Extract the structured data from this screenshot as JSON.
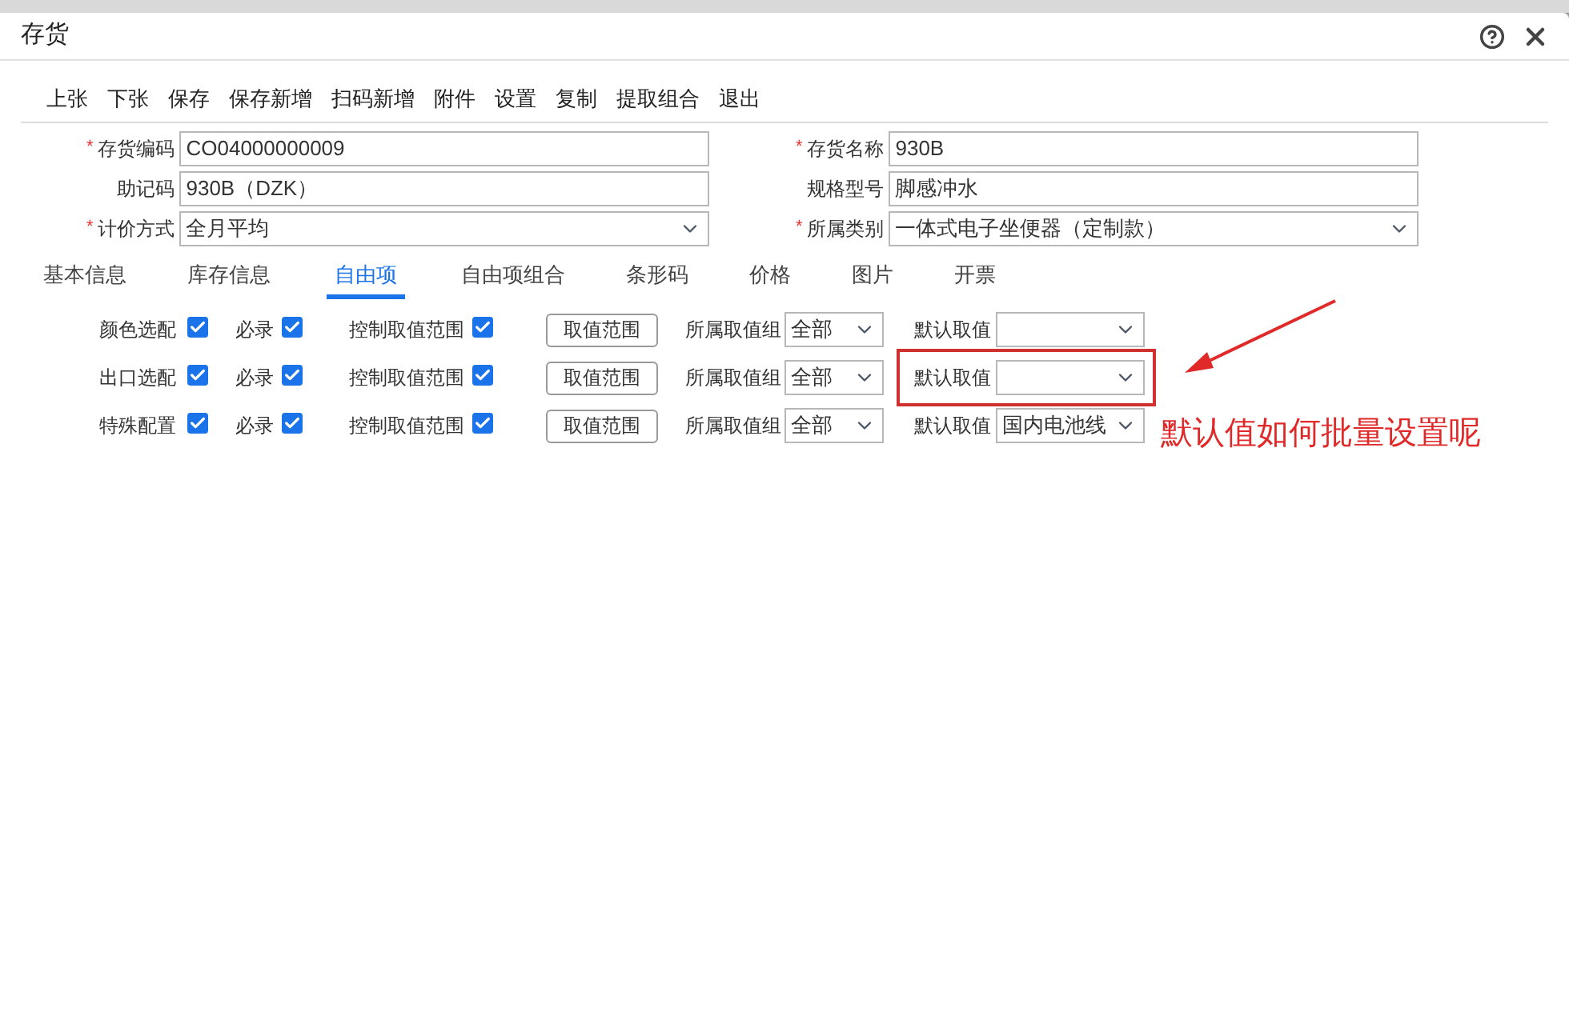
{
  "window": {
    "title": "存货"
  },
  "toolbar": [
    "上张",
    "下张",
    "保存",
    "保存新增",
    "扫码新增",
    "附件",
    "设置",
    "复制",
    "提取组合",
    "退出"
  ],
  "fields": [
    {
      "label": "存货编码",
      "mark": "*",
      "kind": "text",
      "value": "CO04000000009"
    },
    {
      "label": "存货名称",
      "mark": "*",
      "kind": "text",
      "value": "930B"
    },
    {
      "label": "助记码",
      "kind": "text",
      "value": "930B（DZK）"
    },
    {
      "label": "规格型号",
      "kind": "text",
      "value": "脚感冲水"
    },
    {
      "label": "计价方式",
      "mark": "*",
      "kind": "select",
      "value": "全月平均"
    },
    {
      "label": "所属类别",
      "mark": "*",
      "kind": "select",
      "value": "一体式电子坐便器（定制款）"
    }
  ],
  "tabs": [
    {
      "label": "基本信息",
      "selected": false
    },
    {
      "label": "库存信息",
      "selected": false
    },
    {
      "label": "自由项",
      "selected": true
    },
    {
      "label": "自由项组合",
      "selected": false
    },
    {
      "label": "条形码",
      "selected": false
    },
    {
      "label": "价格",
      "selected": false
    },
    {
      "label": "图片",
      "selected": false
    },
    {
      "label": "开票",
      "selected": false
    }
  ],
  "free_items": [
    {
      "name": "颜色选配",
      "checked": true,
      "required_label": "必录",
      "required": true,
      "range_label": "控制取值范围",
      "range_control": true,
      "range_button": "取值范围",
      "group_label": "所属取值组",
      "group": "全部",
      "default_label": "默认取值",
      "annotated": false
    },
    {
      "name": "出口选配",
      "checked": true,
      "required_label": "必录",
      "required": true,
      "range_label": "控制取值范围",
      "range_control": true,
      "range_button": "取值范围",
      "group_label": "所属取值组",
      "group": "全部",
      "default_label": "默认取值",
      "annotated": true
    },
    {
      "name": "特殊配置",
      "checked": true,
      "required_label": "必录",
      "required": true,
      "range_label": "控制取值范围",
      "range_control": true,
      "range_button": "取值范围",
      "group_label": "所属取值组",
      "group": "全部",
      "default_label": "默认取值",
      "default": "国内电池线",
      "annotated": false
    }
  ],
  "annotation": {
    "text": "默认值如何批量设置呢"
  }
}
